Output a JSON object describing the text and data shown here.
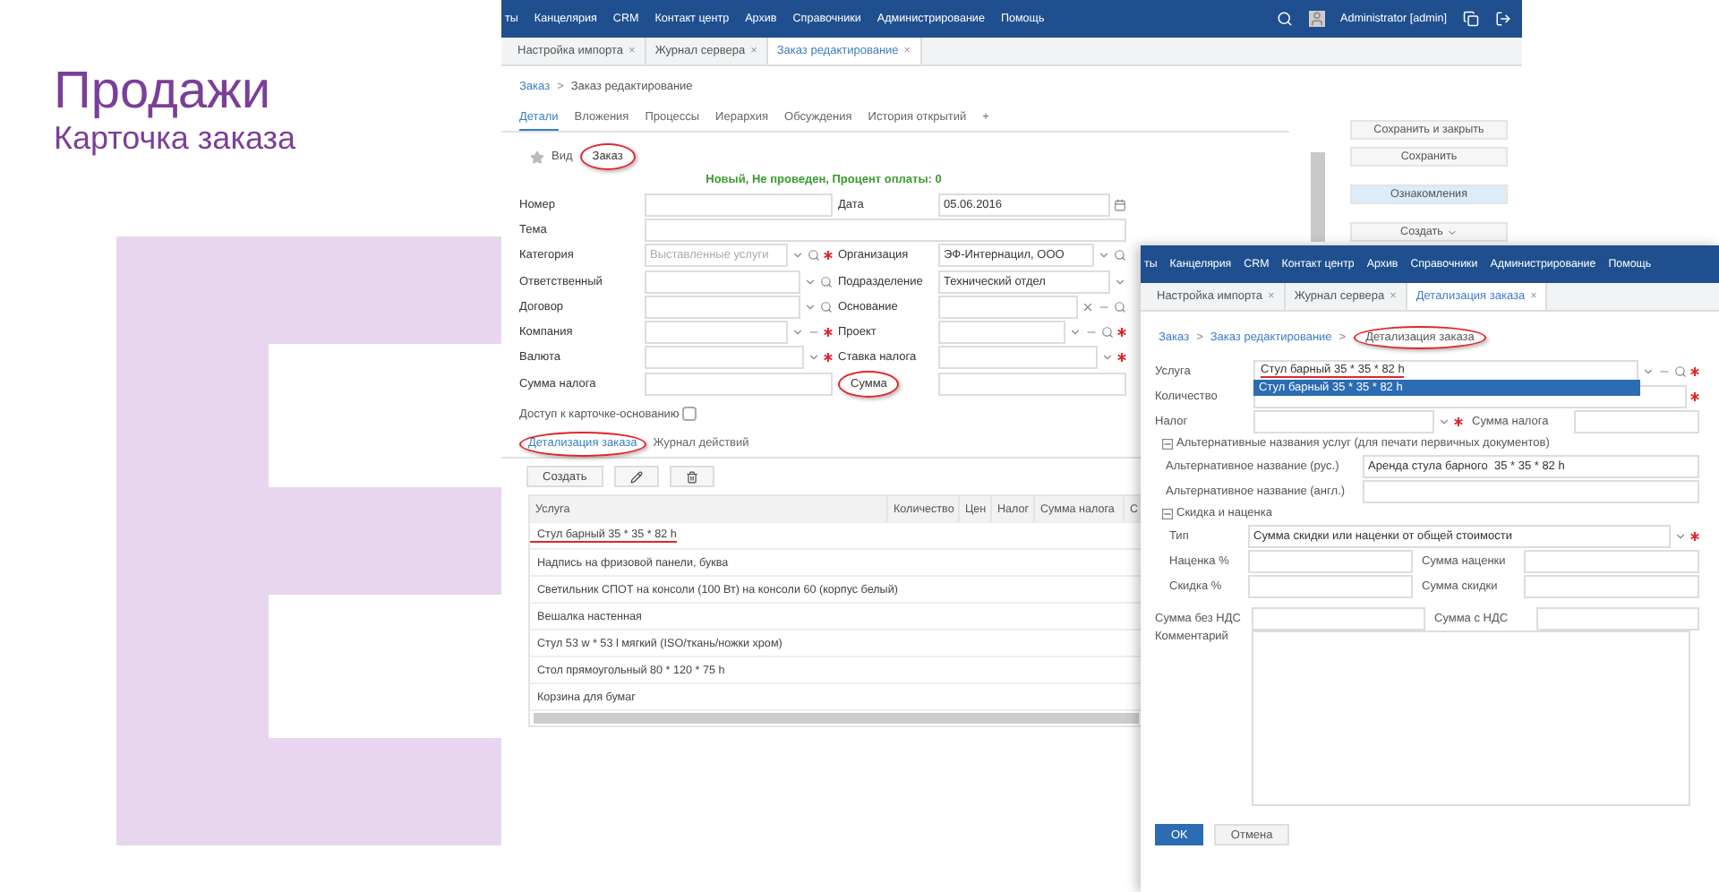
{
  "slide": {
    "title": "Продажи",
    "subtitle": "Карточка заказа"
  },
  "main_window": {
    "menu": [
      "ты",
      "Канцелярия",
      "CRM",
      "Контакт центр",
      "Архив",
      "Справочники",
      "Администрирование",
      "Помощь"
    ],
    "user": "Administrator [admin]",
    "open_tabs": [
      {
        "label": "Настройка импорта",
        "close": "×",
        "selected": false
      },
      {
        "label": "Журнал сервера",
        "close": "×",
        "selected": false
      },
      {
        "label": "Заказ редактирование",
        "close": "×",
        "selected": true
      }
    ],
    "breadcrumb": [
      {
        "label": "Заказ",
        "separator": ">"
      },
      {
        "label": "Заказ редактирование"
      }
    ],
    "detail_tabs": [
      {
        "label": "Детали",
        "selected": true
      },
      {
        "label": "Вложения",
        "selected": false
      },
      {
        "label": "Процессы",
        "selected": false
      },
      {
        "label": "Иерархия",
        "selected": false
      },
      {
        "label": "Обсуждения",
        "selected": false
      },
      {
        "label": "История открытий",
        "selected": false
      },
      {
        "label": "+",
        "selected": false
      }
    ],
    "kind": {
      "label": "Вид",
      "value": "Заказ",
      "circled": true
    },
    "status": "Новый, Не проведен, Процент оплаты: 0",
    "rows": [
      {
        "left": {
          "label": "Номер"
        },
        "right": {
          "label": "Дата",
          "value": "05.06.2016",
          "controls": [
            {
              "kind": "calendar"
            }
          ]
        }
      },
      {
        "left": {
          "label": "Тема",
          "kind": "wide"
        }
      },
      {
        "left": {
          "label": "Категория",
          "placeholder": "Выставленные услуги",
          "controls": [
            {
              "kind": "dropdown"
            },
            {
              "kind": "search"
            }
          ],
          "required": true
        },
        "right": {
          "label": "Организация",
          "value": "ЭФ-Интернацил, ООО",
          "controls": [
            {
              "kind": "dropdown"
            },
            {
              "kind": "search"
            }
          ]
        }
      },
      {
        "left": {
          "label": "Ответственный",
          "controls": [
            {
              "kind": "dropdown"
            },
            {
              "kind": "search"
            }
          ]
        },
        "right": {
          "label": "Подразделение",
          "value": "Технический отдел",
          "controls": [
            {
              "kind": "dropdown"
            }
          ]
        }
      },
      {
        "left": {
          "label": "Договор",
          "controls": [
            {
              "kind": "dropdown"
            },
            {
              "kind": "search"
            }
          ]
        },
        "right": {
          "label": "Основание",
          "controls": [
            {
              "kind": "clear"
            },
            {
              "kind": "more"
            },
            {
              "kind": "search"
            }
          ]
        }
      },
      {
        "left": {
          "label": "Компания",
          "controls": [
            {
              "kind": "dropdown"
            },
            {
              "kind": "more"
            }
          ],
          "required": true
        },
        "right": {
          "label": "Проект",
          "controls": [
            {
              "kind": "dropdown"
            },
            {
              "kind": "more"
            },
            {
              "kind": "search"
            }
          ],
          "required": true
        }
      },
      {
        "left": {
          "label": "Валюта",
          "controls": [
            {
              "kind": "dropdown"
            }
          ],
          "required": true
        },
        "right": {
          "label": "Ставка налога",
          "controls": [
            {
              "kind": "dropdown"
            }
          ],
          "required": true
        }
      },
      {
        "left": {
          "label": "Сумма налога"
        },
        "right": {
          "label": "Сумма",
          "circled": true
        }
      }
    ],
    "access": {
      "label": "Доступ к карточке-основанию",
      "checked": false
    },
    "sub_tabs": [
      {
        "label": "Детализация заказа",
        "selected": true,
        "circled": true
      },
      {
        "label": "Журнал действий",
        "selected": false,
        "circled": false
      }
    ],
    "toolbar": {
      "create": "Создать"
    },
    "table": {
      "columns": [
        "Услуга",
        "Количество",
        "Цен",
        "Налог",
        "Сумма налога",
        "С"
      ],
      "rows": [
        {
          "service": "Стул барный 35 * 35 * 82 h",
          "underlined": true
        },
        {
          "service": "Надпись на фризовой панели, буква",
          "underlined": false
        },
        {
          "service": "Светильник СПОТ на консоли (100 Вт) на консоли 60 (корпус белый)",
          "underlined": false
        },
        {
          "service": "Вешалка настенная",
          "underlined": false
        },
        {
          "service": "Стул 53 w * 53 l мягкий (ISO/ткань/ножки хром)",
          "underlined": false
        },
        {
          "service": "Стол прямоугольный 80 * 120 * 75 h",
          "underlined": false
        },
        {
          "service": "Корзина для бумаг",
          "underlined": false
        }
      ]
    },
    "actions": [
      {
        "label": "Сохранить и закрыть",
        "kind": "plain"
      },
      {
        "label": "Сохранить",
        "kind": "plain"
      },
      {
        "label": "Ознакомления",
        "kind": "accent"
      },
      {
        "label": "Создать",
        "kind": "menu"
      }
    ]
  },
  "detail_window": {
    "menu": [
      "ты",
      "Канцелярия",
      "CRM",
      "Контакт центр",
      "Архив",
      "Справочники",
      "Администрирование",
      "Помощь"
    ],
    "open_tabs": [
      {
        "label": "Настройка импорта",
        "close": "×",
        "selected": false
      },
      {
        "label": "Журнал сервера",
        "close": "×",
        "selected": false
      },
      {
        "label": "Детализация заказа",
        "close": "×",
        "selected": true
      }
    ],
    "breadcrumb": [
      {
        "label": "Заказ",
        "separator": ">",
        "circled": false
      },
      {
        "label": "Заказ редактирование",
        "separator": ">",
        "circled": false
      },
      {
        "label": "Детализация заказа",
        "circled": true
      }
    ],
    "service": {
      "label": "Услуга",
      "value": "Стул барный  35 * 35 * 82 h",
      "underlined": true,
      "suggestion": "Стул барный 35 * 35 * 82 h",
      "required": true
    },
    "quantity": {
      "label": "Количество",
      "required": true
    },
    "tax": {
      "label": "Налог",
      "required": true
    },
    "tax_sum": {
      "label": "Сумма налога"
    },
    "alt_section": {
      "label": "Альтернативные названия услуг (для печати первичных документов)",
      "expanded": true
    },
    "alt_ru": {
      "label": "Альтернативное название (рус.)",
      "value": "Аренда стула барного  35 * 35 * 82 h"
    },
    "alt_en": {
      "label": "Альтернативное название (англ.)"
    },
    "discount_section": {
      "label": "Скидка и наценка",
      "expanded": true
    },
    "type": {
      "label": "Тип",
      "value": "Сумма скидки или наценки от общей стоимости",
      "required": true
    },
    "markup_pct": {
      "label": "Наценка %"
    },
    "markup_sum": {
      "label": "Сумма наценки"
    },
    "discount_pct": {
      "label": "Скидка %"
    },
    "discount_sum": {
      "label": "Сумма скидки"
    },
    "sum_no_vat": {
      "label": "Сумма без НДС"
    },
    "sum_vat": {
      "label": "Сумма с НДС"
    },
    "comment": {
      "label": "Комментарий"
    },
    "buttons": [
      {
        "label": "OK",
        "kind": "primary"
      },
      {
        "label": "Отмена",
        "kind": "plain"
      }
    ]
  }
}
